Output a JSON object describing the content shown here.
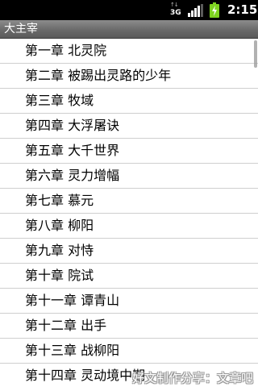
{
  "status_bar": {
    "network_icon": "3g-data-icon",
    "network_label": "3G",
    "signal_icon": "signal-strength-icon",
    "battery_icon": "battery-charging-icon",
    "time": "2:15"
  },
  "title_bar": {
    "title": "大主宰"
  },
  "chapters": [
    {
      "label": "第一章 北灵院"
    },
    {
      "label": "第二章 被踢出灵路的少年"
    },
    {
      "label": "第三章 牧域"
    },
    {
      "label": "第四章 大浮屠诀"
    },
    {
      "label": "第五章 大千世界"
    },
    {
      "label": "第六章 灵力增幅"
    },
    {
      "label": "第七章 慕元"
    },
    {
      "label": "第八章 柳阳"
    },
    {
      "label": "第九章 对恃"
    },
    {
      "label": "第十章 院试"
    },
    {
      "label": "第十一章 谭青山"
    },
    {
      "label": "第十二章 出手"
    },
    {
      "label": "第十三章 战柳阳"
    },
    {
      "label": "第十四章 灵动境中期"
    }
  ],
  "watermark": "好文制作分享：文章吧"
}
